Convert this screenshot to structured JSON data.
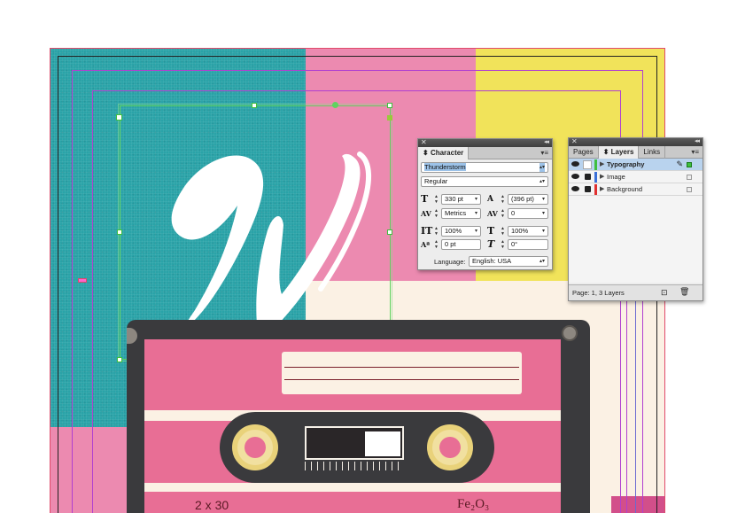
{
  "character_panel": {
    "title": "Character",
    "font_family": "Thunderstorm",
    "font_style": "Regular",
    "font_size": "330 pt",
    "leading": "(396 pt)",
    "kerning": "Metrics",
    "tracking": "0",
    "vertical_scale": "100%",
    "horizontal_scale": "100%",
    "baseline_shift": "0 pt",
    "skew": "0°",
    "language_label": "Language:",
    "language_value": "English: USA"
  },
  "layers_panel": {
    "tabs": [
      "Pages",
      "Layers",
      "Links"
    ],
    "layers": [
      {
        "name": "Typography",
        "color": "#3fbf3f",
        "active": true
      },
      {
        "name": "Image",
        "color": "#3a6fd8",
        "active": false
      },
      {
        "name": "Background",
        "color": "#e03030",
        "active": false
      }
    ],
    "status": "Page: 1, 3 Layers"
  },
  "artwork": {
    "cassette_left_label": "2 x 30",
    "cassette_right_label": "Fe₂O₃",
    "colors": {
      "teal": "#2aa3a8",
      "pink": "#ec8ab0",
      "yellow": "#f1e35a",
      "cream": "#fbf1e4",
      "cassette_pink": "#e86e95",
      "frame_dark": "#3a3a3d"
    }
  }
}
